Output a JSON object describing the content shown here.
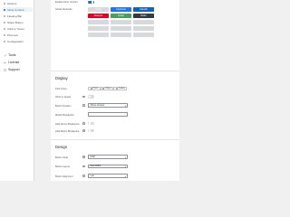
{
  "sidebar": {
    "items": [
      {
        "label": "Options",
        "active": false
      },
      {
        "label": "Inline Content",
        "active": true
      },
      {
        "label": "Floating Bar",
        "active": false
      },
      {
        "label": "Share Button",
        "active": false
      },
      {
        "label": "Click to Tweet",
        "active": false
      },
      {
        "label": "Pinterest",
        "active": false
      },
      {
        "label": "Configuration",
        "active": false
      }
    ],
    "main": [
      {
        "label": "Tools",
        "icon": "tools-icon"
      },
      {
        "label": "License",
        "icon": "key-icon"
      },
      {
        "label": "Support",
        "icon": "help-icon"
      }
    ]
  },
  "general": {
    "enable_label": "Enable Inline Content",
    "networks_label": "Social Networks",
    "networks": [
      {
        "label": "Twitter",
        "color": "#1da1f2",
        "enabled": false
      },
      {
        "label": "Facebook",
        "color": "#1877f2",
        "enabled": true
      },
      {
        "label": "LinkedIn",
        "color": "#0a66c2",
        "enabled": true
      },
      {
        "label": "Pinterest",
        "color": "#e60023",
        "enabled": true
      },
      {
        "label": "Email",
        "color": "#4a9e57",
        "enabled": true
      },
      {
        "label": "Buffer",
        "color": "#323b43",
        "enabled": true
      },
      {
        "label": "",
        "color": "#d7d9dc",
        "enabled": false
      },
      {
        "label": "",
        "color": "#d7d9dc",
        "enabled": false
      },
      {
        "label": "",
        "color": "#d7d9dc",
        "enabled": false
      },
      {
        "label": "",
        "color": "#d7d9dc",
        "enabled": false
      },
      {
        "label": "",
        "color": "#d7d9dc",
        "enabled": false
      },
      {
        "label": "",
        "color": "#d7d9dc",
        "enabled": false
      },
      {
        "label": "",
        "color": "#d7d9dc",
        "enabled": false
      },
      {
        "label": "",
        "color": "#d7d9dc",
        "enabled": false
      },
      {
        "label": "",
        "color": "#d7d9dc",
        "enabled": false
      }
    ]
  },
  "display": {
    "title": "Display",
    "post_types_label": "Post Types",
    "post_types": [
      {
        "label": "Posts",
        "selected": false
      },
      {
        "label": "Pages",
        "selected": false
      },
      {
        "label": "Galaxy",
        "selected": false
      }
    ],
    "show_in_feeds_label": "Show in Feeds",
    "button_position_label": "Button Position",
    "button_position_value": "Above Content",
    "mobile_breakpoint_label": "Mobile Breakpoint",
    "hide_above_label": "Hide Above Breakpoint",
    "hide_below_label": "Hide Below Breakpoint"
  },
  "design": {
    "title": "Design",
    "button_style_label": "Button Style",
    "button_style_value": "Solid",
    "button_layout_label": "Button Layout",
    "button_layout_value": "Auto Width",
    "button_alignment_label": "Button Alignment",
    "button_alignment_value": "Left"
  },
  "colors": {
    "accent": "#2271b1",
    "background": "#f0f0f1"
  }
}
